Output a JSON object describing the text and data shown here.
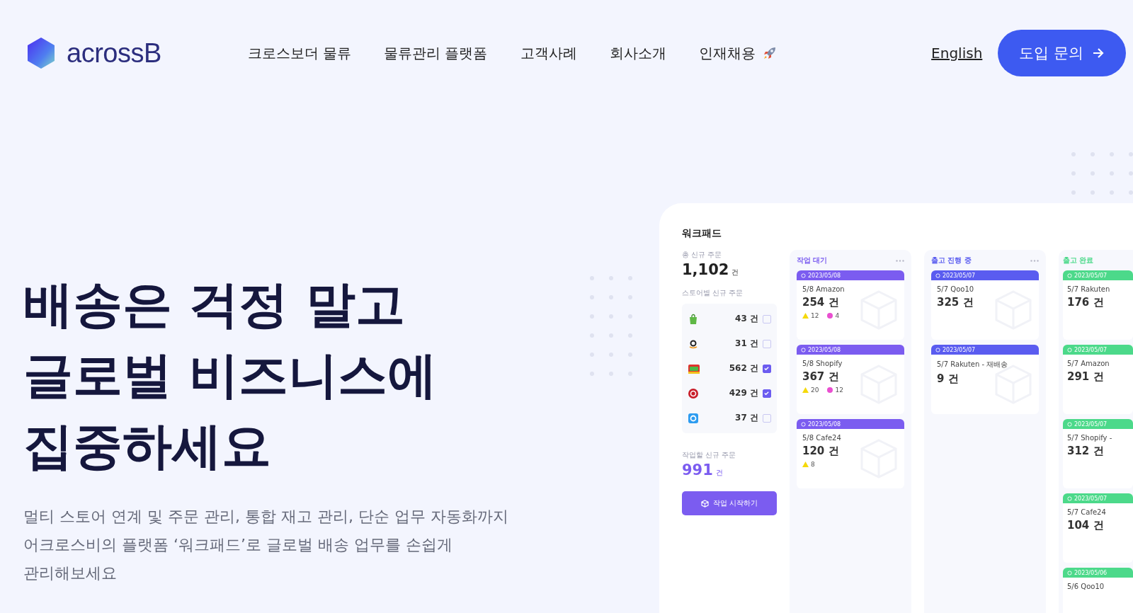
{
  "header": {
    "logo": "acrossB",
    "nav": [
      "크로스보더 물류",
      "물류관리 플랫폼",
      "고객사례",
      "회사소개",
      "인재채용"
    ],
    "language_link": "English",
    "cta_button": "도입 문의"
  },
  "hero": {
    "title_lines": [
      "배송은 걱정 말고",
      "글로벌 비즈니스에",
      "집중하세요"
    ],
    "subtitle_lines": [
      "멀티 스토어 연계 및 주문 관리, 통합 재고 관리, 단순 업무 자동화까지",
      "어크로스비의 플랫폼 ‘워크패드’로 글로벌 배송 업무를 손쉽게",
      "관리해보세요"
    ]
  },
  "dashboard": {
    "title": "워크패드",
    "total_label": "총 신규 주문",
    "total_count": "1,102",
    "total_unit": "건",
    "stores_label": "스토어별 신규 주문",
    "stores": [
      {
        "count": "43 건",
        "checked": false
      },
      {
        "count": "31 건",
        "checked": false
      },
      {
        "count": "562 건",
        "checked": true
      },
      {
        "count": "429 건",
        "checked": true
      },
      {
        "count": "37 건",
        "checked": false
      }
    ],
    "todo_label": "작업할 신규 주문",
    "todo_count": "991",
    "todo_unit": "건",
    "start_button": "작업 시작하기",
    "columns": [
      {
        "title": "작업 대기",
        "color": "#7b5cf0",
        "cards": [
          {
            "date": "2023/05/08",
            "name": "5/8 Amazon",
            "count": "254 건",
            "warnings": "12",
            "flags": "4"
          },
          {
            "date": "2023/05/08",
            "name": "5/8 Shopify",
            "count": "367 건",
            "warnings": "20",
            "flags": "12"
          },
          {
            "date": "2023/05/08",
            "name": "5/8 Cafe24",
            "count": "120 건",
            "warnings": "8"
          }
        ]
      },
      {
        "title": "출고 진행 중",
        "color": "#5a5cf0",
        "cards": [
          {
            "date": "2023/05/07",
            "name": "5/7 Qoo10",
            "count": "325 건"
          },
          {
            "date": "2023/05/07",
            "name": "5/7 Rakuten - 재배송",
            "count": "9 건"
          }
        ]
      },
      {
        "title": "출고 완료",
        "color": "#4cd98a",
        "cards": [
          {
            "date": "2023/05/07",
            "name": "5/7 Rakuten",
            "count": "176 건"
          },
          {
            "date": "2023/05/07",
            "name": "5/7 Amazon",
            "count": "291 건"
          },
          {
            "date": "2023/05/07",
            "name": "5/7 Shopify -",
            "count": "312 건"
          },
          {
            "date": "2023/05/07",
            "name": "5/7 Cafe24",
            "count": "104 건"
          },
          {
            "date": "2023/05/06",
            "name": "5/6 Qoo10"
          }
        ]
      }
    ]
  }
}
